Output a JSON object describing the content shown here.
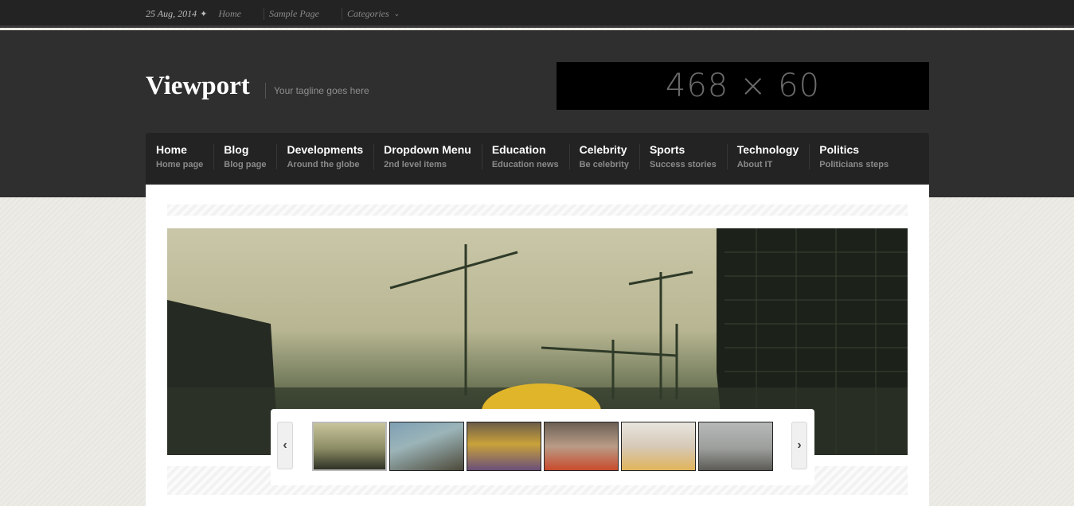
{
  "topbar": {
    "date": "25 Aug, 2014",
    "pin_icon": "pin-icon",
    "links": [
      "Home",
      "Sample Page",
      "Categories"
    ],
    "categories_dropdown_icon": "chevron-down-icon"
  },
  "header": {
    "logo": "Viewport",
    "tagline": "Your tagline goes here",
    "banner_text": "468 × 60"
  },
  "nav": {
    "items": [
      {
        "title": "Home",
        "sub": "Home page"
      },
      {
        "title": "Blog",
        "sub": "Blog page"
      },
      {
        "title": "Developments",
        "sub": "Around the globe"
      },
      {
        "title": "Dropdown Menu",
        "sub": "2nd level items"
      },
      {
        "title": "Education",
        "sub": "Education news"
      },
      {
        "title": "Celebrity",
        "sub": "Be celebrity"
      },
      {
        "title": "Sports",
        "sub": "Success stories"
      },
      {
        "title": "Technology",
        "sub": "About IT"
      },
      {
        "title": "Politics",
        "sub": "Politicians steps"
      }
    ]
  },
  "slider": {
    "prev_icon": "chevron-left-icon",
    "next_icon": "chevron-right-icon",
    "prev_glyph": "‹",
    "next_glyph": "›",
    "thumbnail_count": 6,
    "active_thumbnail": 1
  },
  "colors": {
    "topbar": "#232323",
    "header": "#2f2f2f",
    "nav": "#232323",
    "background": "#ecebe6"
  }
}
